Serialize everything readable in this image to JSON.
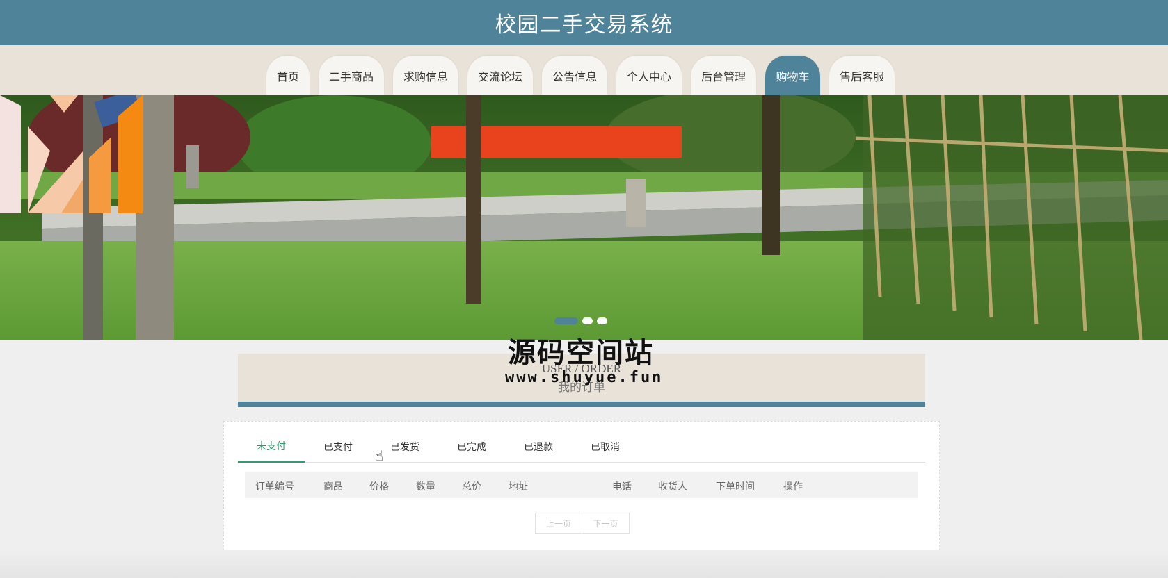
{
  "header": {
    "title": "校园二手交易系统"
  },
  "nav": {
    "items": [
      {
        "label": "首页"
      },
      {
        "label": "二手商品"
      },
      {
        "label": "求购信息"
      },
      {
        "label": "交流论坛"
      },
      {
        "label": "公告信息"
      },
      {
        "label": "个人中心"
      },
      {
        "label": "后台管理"
      },
      {
        "label": "购物车",
        "active": true
      },
      {
        "label": "售后客服"
      }
    ]
  },
  "banner": {
    "slides": 3,
    "active_slide": 1
  },
  "watermark": {
    "text": "源码空间站",
    "url": "www.shuyue.fun"
  },
  "section": {
    "title_en": "USER / ORDER",
    "title_cn": "我的订单"
  },
  "orders": {
    "tabs": [
      "未支付",
      "已支付",
      "已发货",
      "已完成",
      "已退款",
      "已取消"
    ],
    "active_tab": "未支付",
    "columns": [
      "订单编号",
      "商品",
      "价格",
      "数量",
      "总价",
      "地址",
      "电话",
      "收货人",
      "下单时间",
      "操作"
    ],
    "rows": []
  },
  "pager": {
    "prev": "上一页",
    "next": "下一页"
  },
  "colors": {
    "primary": "#4f8399",
    "nav_bg": "#e8e2d9",
    "active_tab": "#2e9e6f"
  }
}
